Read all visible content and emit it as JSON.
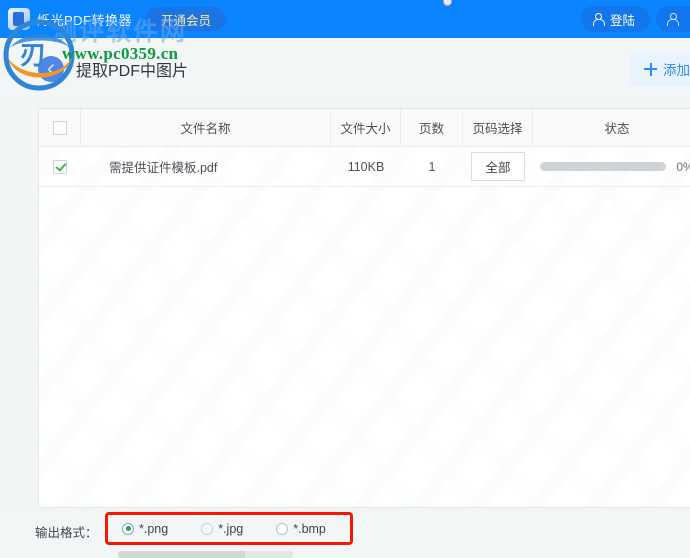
{
  "titlebar": {
    "app_name": "烁光PDF转换器",
    "vip_button": "开通会员",
    "login_button": "登陆",
    "logo_icon": "pdf-app-logo-icon",
    "person_icon": "person-icon"
  },
  "page_header": {
    "back_icon": "arrow-left-icon",
    "title": "提取PDF中图片",
    "add_button": "添加",
    "plus_icon": "plus-icon"
  },
  "table": {
    "headers": {
      "check": "",
      "name": "文件名称",
      "size": "文件大小",
      "pages": "页数",
      "page_select": "页码选择",
      "status": "状态"
    },
    "rows": [
      {
        "checked": true,
        "name": "需提供证件模板.pdf",
        "size": "110KB",
        "pages": "1",
        "page_select": "全部",
        "progress": 0,
        "percent": "0%"
      }
    ]
  },
  "footer": {
    "format_label": "输出格式：",
    "formats": [
      {
        "label": "*.png",
        "selected": true
      },
      {
        "label": "*.jpg",
        "selected": false
      },
      {
        "label": "*.bmp",
        "selected": false
      }
    ],
    "highlight_color": "#fb1403"
  },
  "watermark": {
    "url": "www.pc0359.cn",
    "site_name": "测评软件网",
    "logo_icon": "site-logo-icon"
  },
  "colors": {
    "titlebar_blue": "#0a84ff",
    "accent_blue": "#2a8cf5",
    "page_bg": "#f2f6f7",
    "panel_bg": "#ffffff",
    "green_check": "#3dba4e",
    "watermark_green": "#0a9b3c"
  }
}
